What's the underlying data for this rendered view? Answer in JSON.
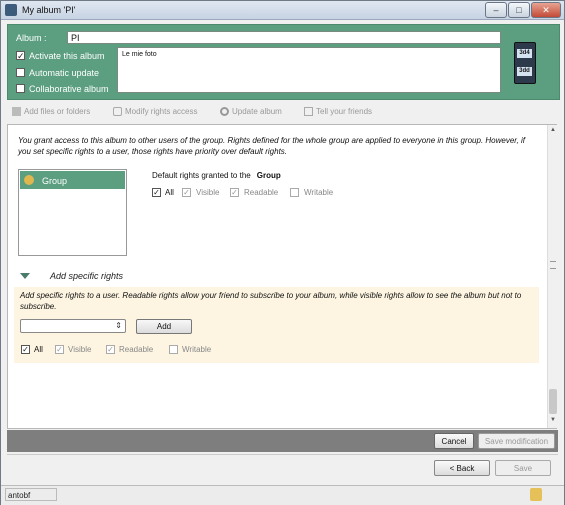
{
  "window": {
    "title": "My album 'PI'",
    "controls": [
      "–",
      "□",
      "✕"
    ]
  },
  "header": {
    "album_label": "Album :",
    "album_value": "PI",
    "options": [
      {
        "label": "Activate this album",
        "checked": true
      },
      {
        "label": "Automatic update",
        "checked": false
      },
      {
        "label": "Collaborative album",
        "checked": false
      }
    ],
    "description": "Le mie foto",
    "icon_labels": [
      "3d4",
      "3dd"
    ]
  },
  "toolbar": [
    {
      "label": "Add files or folders",
      "icon": "add-files-icon",
      "enabled": false
    },
    {
      "label": "Modify rights access",
      "icon": "lock-icon",
      "enabled": false
    },
    {
      "label": "Update album",
      "icon": "refresh-icon",
      "enabled": false
    },
    {
      "label": "Tell your friends",
      "icon": "mail-icon",
      "enabled": false
    }
  ],
  "rights": {
    "intro": "You grant access to this album to other users of the group. Rights defined for the whole group are applied to everyone in this group. However, if you set specific rights to a user, those rights have priority over default rights.",
    "groups": [
      {
        "name": "Group",
        "selected": true
      }
    ],
    "default_label": "Default rights granted to the",
    "default_target": "Group",
    "default_perms": [
      {
        "label": "All",
        "checked": true
      },
      {
        "label": "Visible",
        "checked": true
      },
      {
        "label": "Readable",
        "checked": true
      },
      {
        "label": "Writable",
        "checked": false
      }
    ]
  },
  "specific": {
    "title": "Add specific rights",
    "text": "Add specific rights to a user. Readable rights allow your friend to subscribe to your album, while visible rights allow to see the album but not to subscribe.",
    "user_select_value": "",
    "add_label": "Add",
    "perms": [
      {
        "label": "All",
        "checked": true
      },
      {
        "label": "Visible",
        "checked": true
      },
      {
        "label": "Readable",
        "checked": true
      },
      {
        "label": "Writable",
        "checked": false
      }
    ]
  },
  "actions": {
    "cancel_label": "Cancel",
    "save_mod_label": "Save modification",
    "back_label": "< Back",
    "save_label": "Save"
  },
  "status": {
    "user": "antobf"
  },
  "colors": {
    "accent": "#5b9e80",
    "panel_bg": "#fdf5e2",
    "dark_bar": "#7e7e7e"
  }
}
